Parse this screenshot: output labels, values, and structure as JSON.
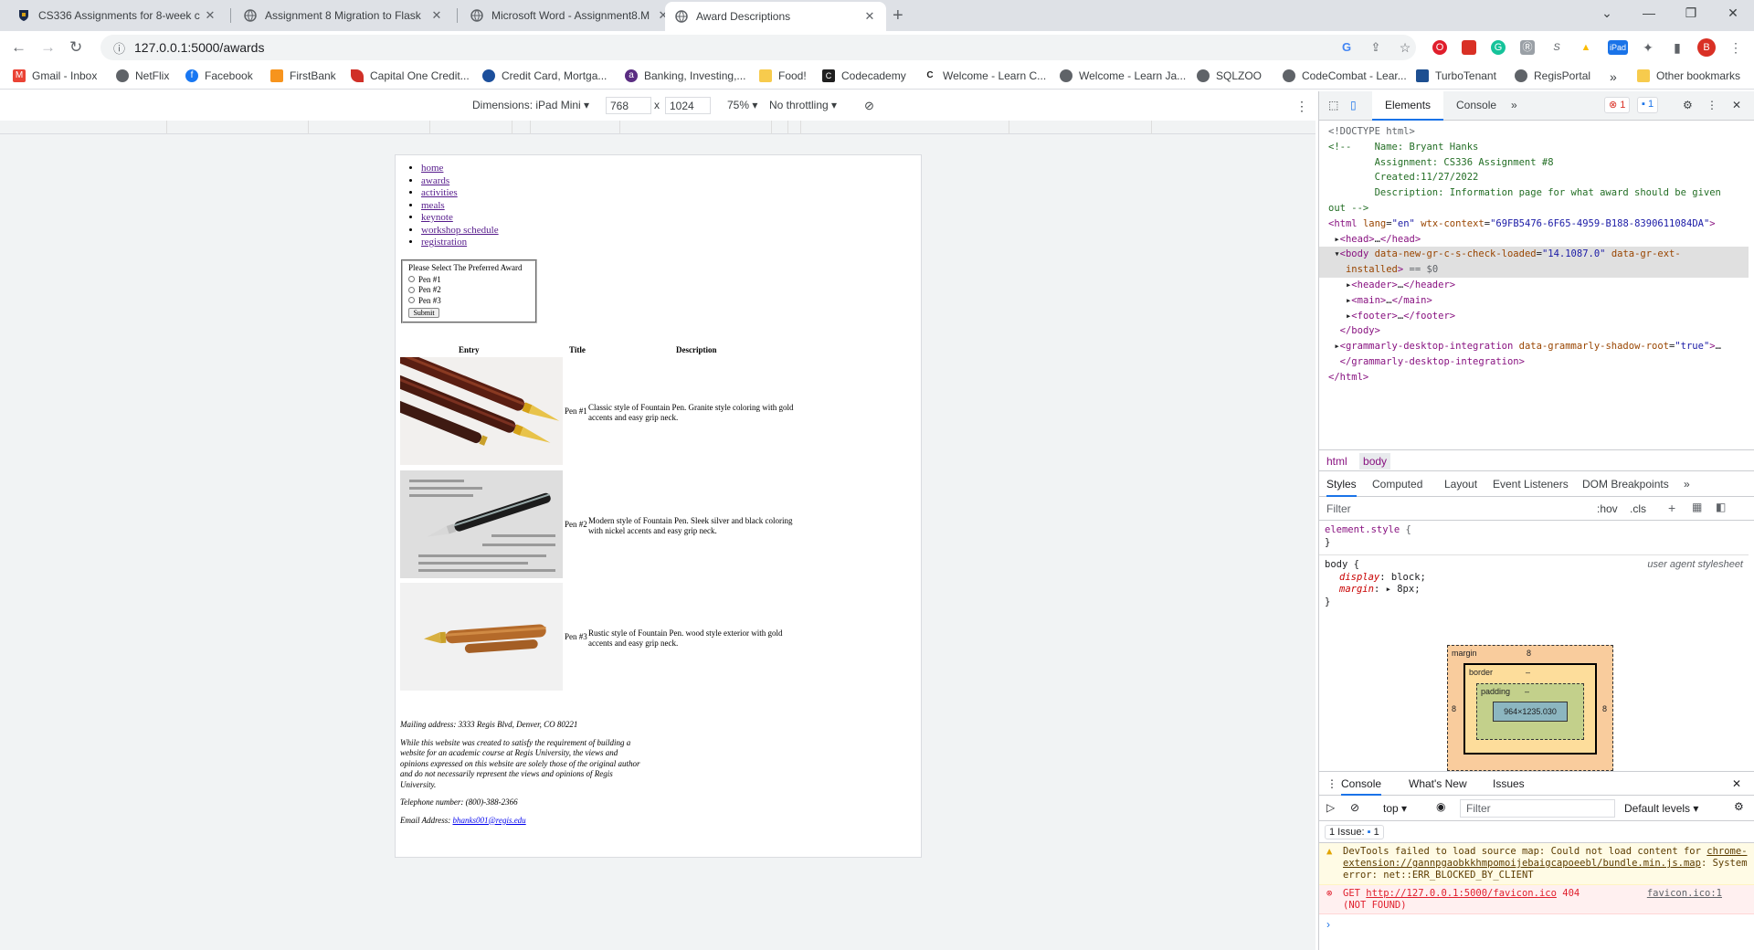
{
  "tabs": [
    {
      "title": "CS336 Assignments for 8-week c",
      "icon": "regis-shield-icon"
    },
    {
      "title": "Assignment 8 Migration to Flask",
      "icon": "globe-icon"
    },
    {
      "title": "Microsoft Word - Assignment8.M",
      "icon": "globe-icon"
    },
    {
      "title": "Award Descriptions",
      "icon": "globe-icon"
    }
  ],
  "toolbar": {
    "url": "127.0.0.1:5000/awards"
  },
  "bookmarks": [
    {
      "label": "Gmail - Inbox",
      "icon": "gmail-icon",
      "color": "#ea4335"
    },
    {
      "label": "NetFlix",
      "icon": "globe-icon",
      "color": "#5f6368"
    },
    {
      "label": "Facebook",
      "icon": "facebook-icon",
      "color": "#1877f2"
    },
    {
      "label": "FirstBank",
      "icon": "firstbank-icon",
      "color": "#f7941d"
    },
    {
      "label": "Capital One Credit...",
      "icon": "capital-one-icon",
      "color": "#d03027"
    },
    {
      "label": "Credit Card, Mortga...",
      "icon": "chase-icon",
      "color": "#1c4f9c"
    },
    {
      "label": "Banking, Investing,...",
      "icon": "banking-icon",
      "color": "#5a2d82"
    },
    {
      "label": "Food!",
      "icon": "folder-icon",
      "color": "#f7cb4d"
    },
    {
      "label": "Codecademy",
      "icon": "codecademy-icon",
      "color": "#1f1f1f"
    },
    {
      "label": "Welcome - Learn C...",
      "icon": "c-icon",
      "color": "#1f1f1f"
    },
    {
      "label": "Welcome - Learn Ja...",
      "icon": "globe-icon",
      "color": "#5f6368"
    },
    {
      "label": "SQLZOO",
      "icon": "globe-icon",
      "color": "#5f6368"
    },
    {
      "label": "CodeCombat - Lear...",
      "icon": "globe-icon",
      "color": "#5f6368"
    },
    {
      "label": "TurboTenant",
      "icon": "turbotenant-icon",
      "color": "#1d4f91"
    },
    {
      "label": "RegisPortal",
      "icon": "globe-icon",
      "color": "#5f6368"
    }
  ],
  "bookmarks_more": "»",
  "other_bookmarks": "Other bookmarks",
  "device_toolbar": {
    "dimensions": "Dimensions: iPad Mini",
    "width": "768",
    "x": "x",
    "height": "1024",
    "zoom": "75%",
    "throttling": "No throttling"
  },
  "page": {
    "nav": [
      "home",
      "awards",
      "activities",
      "meals",
      "keynote",
      "workshop schedule",
      "registration"
    ],
    "form": {
      "legend": "Please Select The Preferred Award",
      "options": [
        "Pen #1",
        "Pen #2",
        "Pen #3"
      ],
      "submit": "Submit"
    },
    "table": {
      "headers": [
        "Entry",
        "Title",
        "Description"
      ],
      "rows": [
        {
          "title": "Pen #1",
          "desc": "Classic style of Fountain Pen. Granite style coloring with gold accents and easy grip neck."
        },
        {
          "title": "Pen #2",
          "desc": "Modern style of Fountain Pen. Sleek silver and black coloring with nickel accents and easy grip neck."
        },
        {
          "title": "Pen #3",
          "desc": "Rustic style of Fountain Pen. wood style exterior with gold accents and easy grip neck."
        }
      ]
    },
    "footer": {
      "mailing": "Mailing address: 3333 Regis Blvd, Denver, CO 80221",
      "disclaimer": "While this website was created to satisfy the requirement of building a website for an academic course at Regis University, the views and opinions expressed on this website are solely those of the original author and do not necessarily represent the views and opinions of Regis University.",
      "phone": "Telephone number: (800)-388-2366",
      "email_label": "Email Address:",
      "email": "bhanks001@regis.edu"
    }
  },
  "devtools": {
    "tabs": [
      "Elements",
      "Console"
    ],
    "errors": "1",
    "messages": "1",
    "breadcrumbs": [
      "html",
      "body"
    ],
    "style_tabs": [
      "Styles",
      "Computed",
      "Layout",
      "Event Listeners",
      "DOM Breakpoints"
    ],
    "filter_placeholder": "Filter",
    "hov": ":hov",
    "cls": ".cls",
    "box_model": {
      "margin_label": "margin",
      "margin": "8",
      "border_label": "border",
      "border": "–",
      "padding_label": "padding",
      "padding": "–",
      "content": "964×1235.030"
    },
    "console_tabs": [
      "Console",
      "What's New",
      "Issues"
    ],
    "context": "top",
    "levels": "Default levels",
    "issues": "1 Issue:",
    "issues_count": "1",
    "warning_msg": "DevTools failed to load source map: Could not load content for",
    "warning_link": "chrome-extension://gannpgaobkkhmpomoijebaigcapoeebl/bundle.min.js.map",
    "warning_rest": ": System error: net::ERR_BLOCKED_BY_CLIENT",
    "error_get": "GET",
    "error_url": "http://127.0.0.1:5000/favicon.ico",
    "error_status": "404",
    "error_status2": "(NOT FOUND)",
    "error_src": "favicon.ico:1"
  }
}
